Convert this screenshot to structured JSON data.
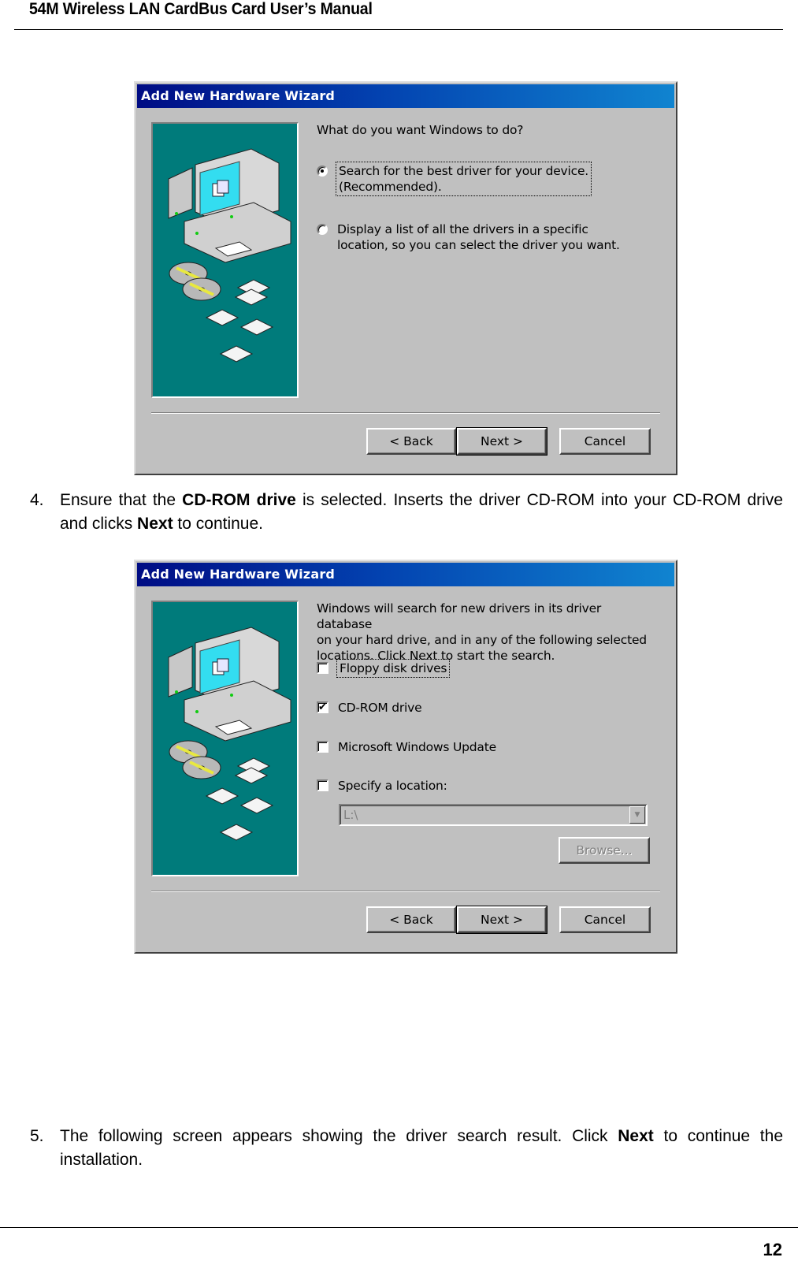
{
  "document": {
    "header_title": "54M Wireless LAN CardBus Card User’s Manual",
    "page_number": "12"
  },
  "steps": [
    {
      "number": "4.",
      "parts": [
        "Ensure that the ",
        "CD-ROM drive",
        " is selected. Inserts the driver CD-ROM into your CD-ROM drive and clicks ",
        "Next",
        " to continue."
      ]
    },
    {
      "number": "5.",
      "parts": [
        "The following screen appears showing the driver search result. Click ",
        "Next",
        " to continue the installation."
      ]
    }
  ],
  "dialog1": {
    "title": "Add New Hardware Wizard",
    "prompt": "What do you want Windows to do?",
    "options": [
      {
        "line1": "Search for the best driver for your device.",
        "line2": "(Recommended).",
        "selected": true
      },
      {
        "line1": "Display a list of all the drivers in a specific",
        "line2": "location, so you can select the driver you want.",
        "selected": false
      }
    ],
    "buttons": {
      "back": "< Back",
      "next": "Next >",
      "cancel": "Cancel"
    }
  },
  "dialog2": {
    "title": "Add New Hardware Wizard",
    "description": [
      "Windows will search for new drivers in its driver database",
      "on your hard drive, and in any of the following selected",
      "locations. Click Next to start the search."
    ],
    "checkboxes": [
      {
        "label": "Floppy disk drives",
        "checked": false,
        "mark": ""
      },
      {
        "label": "CD-ROM drive",
        "checked": true,
        "mark": "✔"
      },
      {
        "label": "Microsoft Windows Update",
        "checked": false,
        "mark": ""
      },
      {
        "label": "Specify a location:",
        "checked": false,
        "mark": ""
      }
    ],
    "location_value": "L:\\",
    "combo_arrow": "▼",
    "browse_label": "Browse...",
    "buttons": {
      "back": "< Back",
      "next": "Next >",
      "cancel": "Cancel"
    }
  },
  "colors": {
    "titlebar_start": "#000c84",
    "titlebar_end": "#1084d0",
    "dialog_face": "#c0c0c0",
    "art_background": "#007b7b"
  }
}
